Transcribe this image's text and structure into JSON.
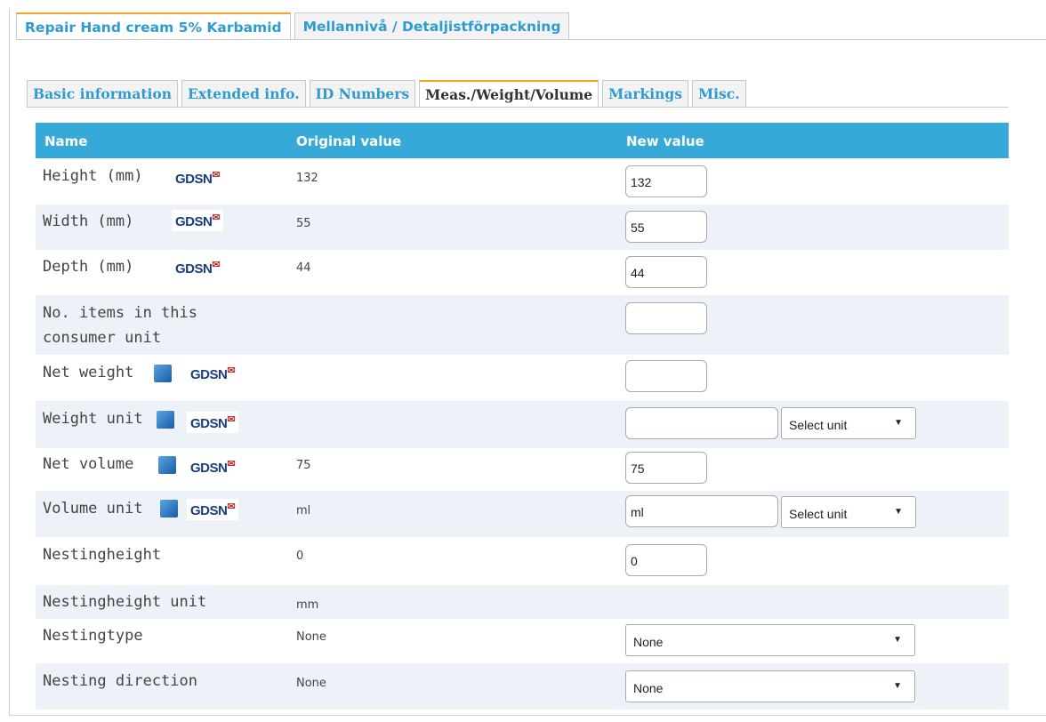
{
  "top_tabs": [
    {
      "label": "Repair Hand cream 5% Karbamid",
      "active": true
    },
    {
      "label": "Mellannivå / Detaljistförpackning",
      "active": false
    }
  ],
  "sub_tabs": [
    {
      "label": "Basic information",
      "active": false
    },
    {
      "label": "Extended info.",
      "active": false
    },
    {
      "label": "ID Numbers",
      "active": false
    },
    {
      "label": "Meas./Weight/Volume",
      "active": true
    },
    {
      "label": "Markings",
      "active": false
    },
    {
      "label": "Misc.",
      "active": false
    }
  ],
  "table": {
    "headers": {
      "name": "Name",
      "original": "Original value",
      "new": "New value"
    },
    "gdsn_badge": "GDSN",
    "rows": [
      {
        "name": "Height (mm)",
        "original": "132",
        "new": "132"
      },
      {
        "name": "Width (mm)",
        "original": "55",
        "new": "55"
      },
      {
        "name": "Depth (mm)",
        "original": "44",
        "new": "44"
      },
      {
        "name_line1": "No. items in this",
        "name_line2": "consumer unit",
        "original": "",
        "new": ""
      },
      {
        "name": "Net weight",
        "original": "",
        "new": ""
      },
      {
        "name": "Weight unit",
        "original": "",
        "new": "",
        "select": "Select unit"
      },
      {
        "name": "Net volume",
        "original": "75",
        "new": "75"
      },
      {
        "name": "Volume unit",
        "original": "ml",
        "new": "ml",
        "select": "Select unit"
      },
      {
        "name": "Nestingheight",
        "original": "0",
        "new": "0"
      },
      {
        "name": "Nestingheight unit",
        "original": "mm"
      },
      {
        "name": "Nestingtype",
        "original": "None",
        "select": "None"
      },
      {
        "name": "Nesting direction",
        "original": "None",
        "select": "None"
      }
    ]
  },
  "icons": {
    "dropdown": "triangle-down-icon",
    "globe": "globe-flag-icon"
  },
  "colors": {
    "header_bg": "#36a9d9",
    "tab_text": "#2e9bd3",
    "tab_active_border": "#f1a42a",
    "row_alt": "#edf2f8"
  }
}
